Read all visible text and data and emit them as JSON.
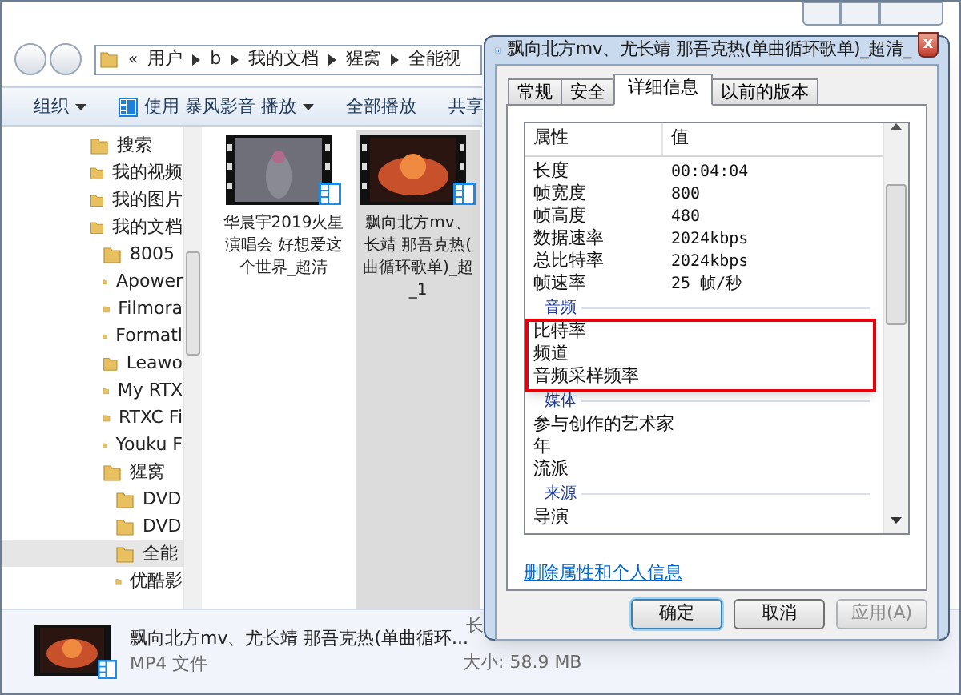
{
  "explorer": {
    "address_overflow": "«",
    "address": [
      "用户",
      "b",
      "我的文档",
      "猩窝",
      "全能视"
    ],
    "toolbar": [
      {
        "label": "组织",
        "dropdown": true,
        "kind": "menu"
      },
      {
        "label": "使用 暴风影音 播放",
        "dropdown": true,
        "kind": "player"
      },
      {
        "label": "全部播放",
        "dropdown": false,
        "kind": "menu"
      },
      {
        "label": "共享",
        "dropdown": false,
        "kind": "menu"
      }
    ],
    "nav": [
      {
        "label": "搜索",
        "selected": false
      },
      {
        "label": "我的视频",
        "selected": false
      },
      {
        "label": "我的图片",
        "selected": false
      },
      {
        "label": "我的文档",
        "selected": false,
        "children": [
          {
            "label": "8005",
            "selected": false
          },
          {
            "label": "Apower",
            "selected": false
          },
          {
            "label": "Filmora",
            "selected": false
          },
          {
            "label": "Formatl",
            "selected": false
          },
          {
            "label": "Leawo",
            "selected": false
          },
          {
            "label": "My RTX",
            "selected": false
          },
          {
            "label": "RTXC Fi",
            "selected": false
          },
          {
            "label": "Youku F",
            "selected": false
          },
          {
            "label": "猩窝",
            "selected": false,
            "children": [
              {
                "label": "DVD",
                "selected": false
              },
              {
                "label": "DVD",
                "selected": false
              },
              {
                "label": "全能",
                "selected": true
              },
              {
                "label": "优酷影",
                "selected": false
              }
            ]
          }
        ]
      }
    ],
    "files": [
      {
        "lines": [
          "华晨宇2019火星",
          "演唱会 好想爱这",
          "个世界_超清"
        ],
        "selected": false
      },
      {
        "lines": [
          "飘向北方mv、",
          "长靖 那吾克热(",
          "曲循环歌单)_超",
          "_1"
        ],
        "selected": true
      }
    ],
    "details": {
      "name": "飘向北方mv、尤长靖 那吾克热(单曲循环...",
      "type": "MP4 文件",
      "column_2": "长",
      "size": "大小: 58.9 MB"
    }
  },
  "dialog": {
    "title": "飘向北方mv、尤长靖 那吾克热(单曲循环歌单)_超清_",
    "close": "x",
    "tabs": [
      {
        "label": "常规",
        "selected": false
      },
      {
        "label": "安全",
        "selected": false
      },
      {
        "label": "详细信息",
        "selected": true
      },
      {
        "label": "以前的版本",
        "selected": false
      }
    ],
    "columns": [
      "属性",
      "值"
    ],
    "sections": [
      {
        "highlighted": false,
        "rows": [
          {
            "name": "长度",
            "value": "00:04:04"
          },
          {
            "name": "帧宽度",
            "value": "800"
          },
          {
            "name": "帧高度",
            "value": "480"
          },
          {
            "name": "数据速率",
            "value": "2024kbps"
          },
          {
            "name": "总比特率",
            "value": "2024kbps"
          },
          {
            "name": "帧速率",
            "value": "25 帧/秒"
          }
        ]
      },
      {
        "heading": "音频",
        "highlighted": true,
        "rows": [
          {
            "name": "比特率"
          },
          {
            "name": "频道"
          },
          {
            "name": "音频采样频率"
          }
        ]
      },
      {
        "heading": "媒体",
        "highlighted": false,
        "rows": [
          {
            "name": "参与创作的艺术家"
          },
          {
            "name": "年"
          },
          {
            "name": "流派"
          }
        ]
      },
      {
        "heading": "来源",
        "highlighted": false,
        "rows": [
          {
            "name": "导演"
          }
        ]
      }
    ],
    "link": "删除属性和个人信息",
    "buttons": [
      {
        "label": "确定",
        "default": true,
        "disabled": false
      },
      {
        "label": "取消",
        "default": false,
        "disabled": false
      },
      {
        "label": "应用(A)",
        "default": false,
        "disabled": true
      }
    ]
  }
}
